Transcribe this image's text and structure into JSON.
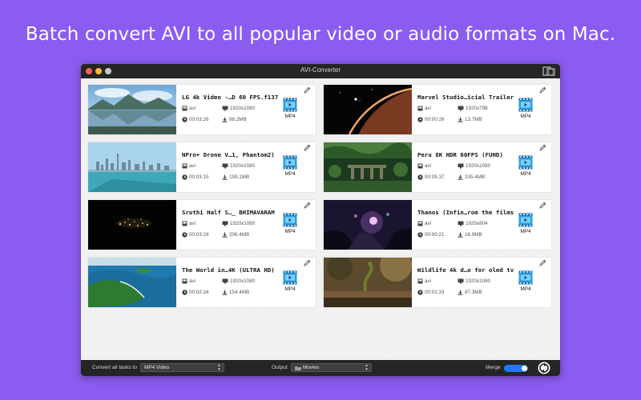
{
  "headline": "Batch convert AVI to all popular video or audio formats on Mac.",
  "window": {
    "title": "AVI-Converter"
  },
  "items": [
    {
      "title": "LG 4k Video -…D 60 FPS.f137",
      "ext": "avi",
      "resolution": "1920x1080",
      "duration": "00:03:26",
      "size": "98.2MB",
      "format": "MP4",
      "thumb": "lake-mountains"
    },
    {
      "title": "Marvel Studio…icial Trailer",
      "ext": "avi",
      "resolution": "1920x798",
      "duration": "00:00:26",
      "size": "13.7MB",
      "format": "MP4",
      "thumb": "planet-space"
    },
    {
      "title": "NPro+ Drone V…1, Phantom2)",
      "ext": "avi",
      "resolution": "1920x1080",
      "duration": "00:03:15",
      "size": "199.1MB",
      "format": "MP4",
      "thumb": "city-skyline"
    },
    {
      "title": "Peru 8K HDR 60FPS (FUHD)",
      "ext": "avi",
      "resolution": "1920x1080",
      "duration": "00:05:37",
      "size": "335.4MB",
      "format": "MP4",
      "thumb": "jungle-ruins"
    },
    {
      "title": "Sruthi Half S…_ BHIMAVARAM",
      "ext": "avi",
      "resolution": "1920x1080",
      "duration": "00:03:24",
      "size": "206.4MB",
      "format": "MP4",
      "thumb": "night-lights"
    },
    {
      "title": "Thanos (Infin…rom the films",
      "ext": "avi",
      "resolution": "1920x804",
      "duration": "00:00:21",
      "size": "16.9MB",
      "format": "MP4",
      "thumb": "movie-scene"
    },
    {
      "title": "The World in…4K (ULTRA HD)",
      "ext": "avi",
      "resolution": "1920x1080",
      "duration": "00:02:34",
      "size": "154.4MB",
      "format": "MP4",
      "thumb": "tropical-coast"
    },
    {
      "title": "Wildlife 4k d…o for oled tv",
      "ext": "avi",
      "resolution": "1920x1080",
      "duration": "00:01:33",
      "size": "87.3MB",
      "format": "MP4",
      "thumb": "wildlife-snake"
    }
  ],
  "bottom": {
    "convert_all_label": "Convert all tasks to",
    "convert_all_value": "MP4 Video",
    "output_label": "Output",
    "output_value": "Movies",
    "merge_label": "Merge",
    "merge_on": true
  },
  "colors": {
    "background": "#8a5cf0",
    "toggle": "#1f78ff",
    "format_icon": "#2d9fe0"
  }
}
